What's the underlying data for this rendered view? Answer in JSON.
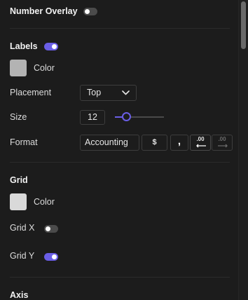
{
  "number_overlay": {
    "label": "Number Overlay",
    "enabled": false
  },
  "labels": {
    "heading": "Labels",
    "enabled": true,
    "color_label": "Color",
    "color": "#b3b3b3",
    "placement": {
      "label": "Placement",
      "value": "Top"
    },
    "size": {
      "label": "Size",
      "value": "12",
      "slider_fraction": 0.22
    },
    "format": {
      "label": "Format",
      "value": "Accounting",
      "currency_button": "$",
      "comma_button": ",",
      "decrease_decimals_text": ".00",
      "increase_decimals_text": ".00"
    }
  },
  "grid": {
    "heading": "Grid",
    "color_label": "Color",
    "color": "#d9d9d9",
    "grid_x": {
      "label": "Grid X",
      "enabled": false
    },
    "grid_y": {
      "label": "Grid Y",
      "enabled": true
    }
  },
  "axis": {
    "heading": "Axis"
  },
  "colors": {
    "accent": "#6a5ee6",
    "toggle_off": "#4b4b4b",
    "background": "#1c1c1c"
  }
}
